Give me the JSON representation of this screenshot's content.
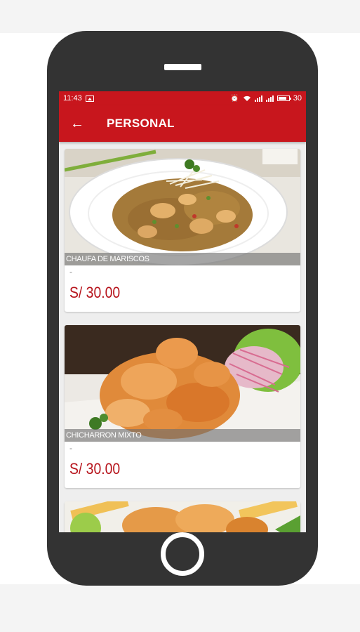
{
  "status_bar": {
    "time": "11:43",
    "battery": "30",
    "icons": [
      "image-icon",
      "alarm-icon",
      "wifi-icon",
      "signal-icon",
      "signal-icon",
      "battery-icon"
    ]
  },
  "app_bar": {
    "title": "PERSONAL",
    "back_icon": "arrow-left-icon"
  },
  "colors": {
    "primary": "#c8161d",
    "price": "#b6121a",
    "phone_frame": "#333333"
  },
  "menu": {
    "items": [
      {
        "name": "CHAUFA DE MARISCOS",
        "description": "-",
        "price": "S/  30.00"
      },
      {
        "name": "CHICHARRON MIXTO",
        "description": "-",
        "price": "S/  30.00"
      },
      {
        "name": "",
        "description": "",
        "price": ""
      }
    ]
  }
}
